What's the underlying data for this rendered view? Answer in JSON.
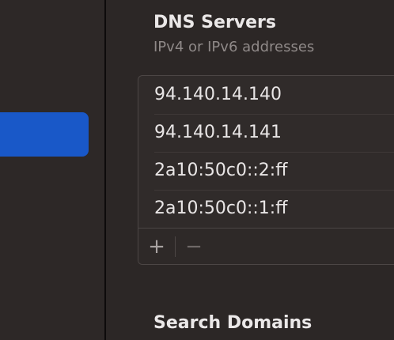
{
  "dns": {
    "title": "DNS Servers",
    "subtitle": "IPv4 or IPv6 addresses",
    "servers": [
      "94.140.14.140",
      "94.140.14.141",
      "2a10:50c0::2:ff",
      "2a10:50c0::1:ff"
    ],
    "add_label": "+",
    "remove_label": "−"
  },
  "search_domains": {
    "title": "Search Domains"
  },
  "colors": {
    "accent": "#1958c8",
    "background": "#2c2726"
  }
}
